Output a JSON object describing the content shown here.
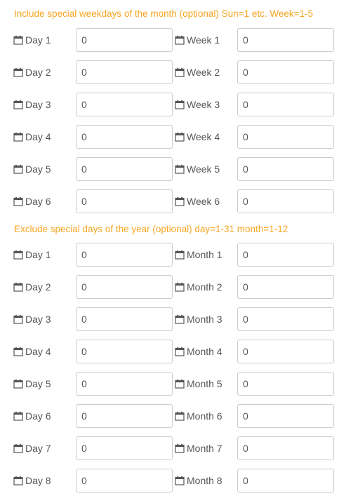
{
  "sections": [
    {
      "title": "Include special weekdays of the month (optional) Sun=1 etc. Week=1-5",
      "rows": [
        {
          "left_label": "Day 1",
          "left_value": "0",
          "right_label": "Week 1",
          "right_value": "0"
        },
        {
          "left_label": "Day 2",
          "left_value": "0",
          "right_label": "Week 2",
          "right_value": "0"
        },
        {
          "left_label": "Day 3",
          "left_value": "0",
          "right_label": "Week 3",
          "right_value": "0"
        },
        {
          "left_label": "Day 4",
          "left_value": "0",
          "right_label": "Week 4",
          "right_value": "0"
        },
        {
          "left_label": "Day 5",
          "left_value": "0",
          "right_label": "Week 5",
          "right_value": "0"
        },
        {
          "left_label": "Day 6",
          "left_value": "0",
          "right_label": "Week 6",
          "right_value": "0"
        }
      ]
    },
    {
      "title": "Exclude special days of the year (optional) day=1-31 month=1-12",
      "rows": [
        {
          "left_label": "Day 1",
          "left_value": "0",
          "right_label": "Month 1",
          "right_value": "0"
        },
        {
          "left_label": "Day 2",
          "left_value": "0",
          "right_label": "Month 2",
          "right_value": "0"
        },
        {
          "left_label": "Day 3",
          "left_value": "0",
          "right_label": "Month 3",
          "right_value": "0"
        },
        {
          "left_label": "Day 4",
          "left_value": "0",
          "right_label": "Month 4",
          "right_value": "0"
        },
        {
          "left_label": "Day 5",
          "left_value": "0",
          "right_label": "Month 5",
          "right_value": "0"
        },
        {
          "left_label": "Day 6",
          "left_value": "0",
          "right_label": "Month 6",
          "right_value": "0"
        },
        {
          "left_label": "Day 7",
          "left_value": "0",
          "right_label": "Month 7",
          "right_value": "0"
        },
        {
          "left_label": "Day 8",
          "left_value": "0",
          "right_label": "Month 8",
          "right_value": "0"
        }
      ]
    }
  ],
  "icon": "calendar-icon",
  "colors": {
    "section_title": "#f5a623",
    "label": "#555555",
    "border": "#cccccc"
  }
}
